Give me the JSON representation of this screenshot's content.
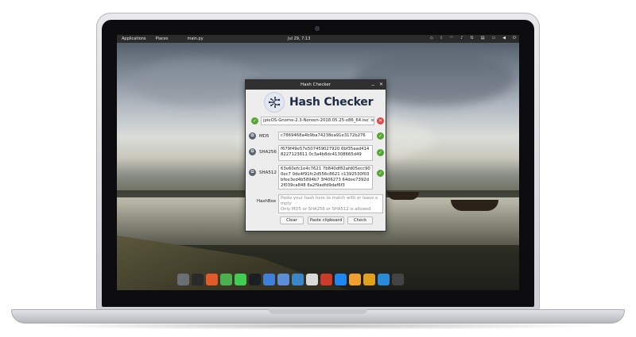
{
  "panel": {
    "applications": "Applications",
    "places": "Places",
    "active_app": "main.py",
    "clock": "Jul 29, 7:13",
    "tray_icons": [
      "dropbox-icon",
      "bluetooth-icon",
      "wifi-icon",
      "volume-icon",
      "network-icon",
      "clipboard-icon",
      "display-icon",
      "sound-icon",
      "power-icon"
    ]
  },
  "window": {
    "title": "Hash Checker",
    "minimize": "_",
    "close": "✕",
    "app_name": "Hash Checker",
    "file_path": "jpieOS-Gnome-2.3-Noreen-2018.05.25-x86_64.iso' is loa",
    "md5": {
      "label": "MD5",
      "value": "c7869468a4b9ba74238ea91e3172b276"
    },
    "sha256": {
      "label": "SHA256",
      "value": "f679f49e57e507459027920 6bf35aad4148227123811 0c3a4b8dc41308665d49"
    },
    "sha512": {
      "label": "SHA512",
      "value": "63e60efc1e4c7621 7b840df82afd05ecc900ec7 0de4f91fc2d556c8621 c1392530f03bfee3ed4b5894b7 3f406273 64dee7392d2f039ca848 8a2f9adfd9daf6f3"
    },
    "hashbox": {
      "label": "HashBox",
      "placeholder_lines": [
        "Paste your hash here to match with or leave empty",
        "Only MD5 or SHA256 or SHA512 is allowed"
      ]
    },
    "buttons": {
      "clear": "Clear",
      "paste": "Paste clipboard",
      "check": "Check"
    }
  },
  "dock": {
    "apps": [
      {
        "name": "files",
        "color": "#6b6f75"
      },
      {
        "name": "terminal",
        "color": "#2a2a2a"
      },
      {
        "name": "apps-grid",
        "color": "#e35a2a"
      },
      {
        "name": "git",
        "color": "#4caf50"
      },
      {
        "name": "qt-creator",
        "color": "#41cd52"
      },
      {
        "name": "pycharm",
        "color": "#1b1f24"
      },
      {
        "name": "chrome",
        "color": "#3f7fd8"
      },
      {
        "name": "code-editor",
        "color": "#5b8dd8"
      },
      {
        "name": "picture",
        "color": "#3a86c8"
      },
      {
        "name": "notes",
        "color": "#d9d9d9"
      },
      {
        "name": "bug-tracker",
        "color": "#cc3b2a"
      },
      {
        "name": "messenger",
        "color": "#1f86f2"
      },
      {
        "name": "downloader",
        "color": "#f0a030"
      },
      {
        "name": "sync",
        "color": "#e0a11b"
      },
      {
        "name": "lock",
        "color": "#2a8ad9"
      },
      {
        "name": "show-apps",
        "color": "#444"
      }
    ]
  }
}
